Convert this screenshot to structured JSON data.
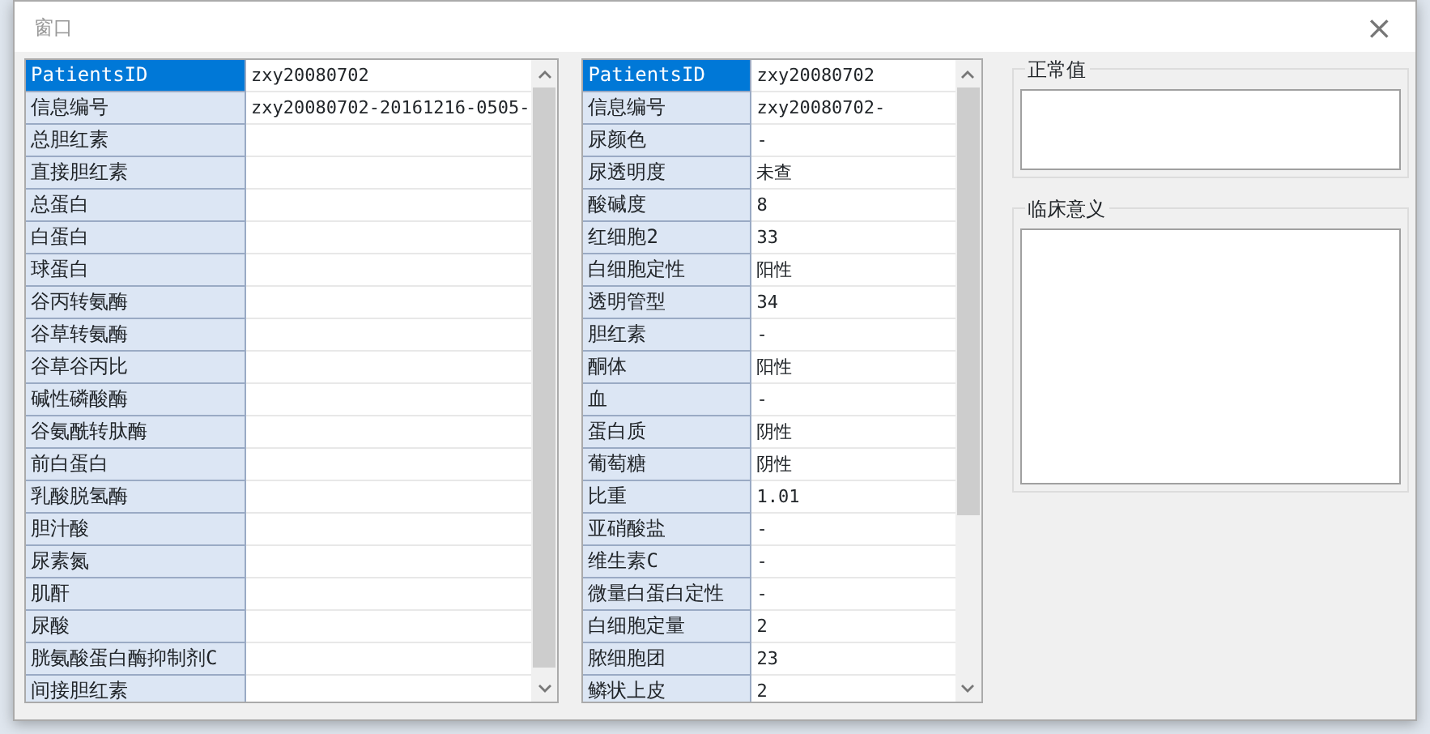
{
  "window": {
    "title": "窗口",
    "close": "×"
  },
  "grids": [
    {
      "rows": [
        {
          "name": "PatientsID",
          "value": "zxy20080702",
          "selected": true
        },
        {
          "name": "信息编号",
          "value": "zxy20080702-20161216-0505-",
          "selected": false
        },
        {
          "name": "总胆红素",
          "value": "",
          "selected": false
        },
        {
          "name": "直接胆红素",
          "value": "",
          "selected": false
        },
        {
          "name": "总蛋白",
          "value": "",
          "selected": false
        },
        {
          "name": "白蛋白",
          "value": "",
          "selected": false
        },
        {
          "name": "球蛋白",
          "value": "",
          "selected": false
        },
        {
          "name": "谷丙转氨酶",
          "value": "",
          "selected": false
        },
        {
          "name": "谷草转氨酶",
          "value": "",
          "selected": false
        },
        {
          "name": "谷草谷丙比",
          "value": "",
          "selected": false
        },
        {
          "name": "碱性磷酸酶",
          "value": "",
          "selected": false
        },
        {
          "name": "谷氨酰转肽酶",
          "value": "",
          "selected": false
        },
        {
          "name": "前白蛋白",
          "value": "",
          "selected": false
        },
        {
          "name": "乳酸脱氢酶",
          "value": "",
          "selected": false
        },
        {
          "name": "胆汁酸",
          "value": "",
          "selected": false
        },
        {
          "name": "尿素氮",
          "value": "",
          "selected": false
        },
        {
          "name": "肌酐",
          "value": "",
          "selected": false
        },
        {
          "name": "尿酸",
          "value": "",
          "selected": false
        },
        {
          "name": "胱氨酸蛋白酶抑制剂C",
          "value": "",
          "selected": false
        },
        {
          "name": "间接胆红素",
          "value": "",
          "selected": false
        }
      ]
    },
    {
      "rows": [
        {
          "name": "PatientsID",
          "value": "zxy20080702",
          "selected": true
        },
        {
          "name": "信息编号",
          "value": "zxy20080702-",
          "selected": false
        },
        {
          "name": "尿颜色",
          "value": "-",
          "selected": false
        },
        {
          "name": "尿透明度",
          "value": "未查",
          "selected": false
        },
        {
          "name": "酸碱度",
          "value": "8",
          "selected": false
        },
        {
          "name": "红细胞2",
          "value": "33",
          "selected": false
        },
        {
          "name": "白细胞定性",
          "value": "阳性",
          "selected": false
        },
        {
          "name": "透明管型",
          "value": "34",
          "selected": false
        },
        {
          "name": "胆红素",
          "value": "-",
          "selected": false
        },
        {
          "name": "酮体",
          "value": "阳性",
          "selected": false
        },
        {
          "name": "血",
          "value": "-",
          "selected": false
        },
        {
          "name": "蛋白质",
          "value": "阴性",
          "selected": false
        },
        {
          "name": "葡萄糖",
          "value": "阴性",
          "selected": false
        },
        {
          "name": "比重",
          "value": "1.01",
          "selected": false
        },
        {
          "name": "亚硝酸盐",
          "value": "-",
          "selected": false
        },
        {
          "name": "维生素C",
          "value": "-",
          "selected": false
        },
        {
          "name": "微量白蛋白定性",
          "value": "-",
          "selected": false
        },
        {
          "name": "白细胞定量",
          "value": "2",
          "selected": false
        },
        {
          "name": "脓细胞团",
          "value": "23",
          "selected": false
        },
        {
          "name": "鳞状上皮",
          "value": "2",
          "selected": false
        }
      ]
    }
  ],
  "groups": [
    {
      "title": "正常值"
    },
    {
      "title": "临床意义"
    }
  ]
}
